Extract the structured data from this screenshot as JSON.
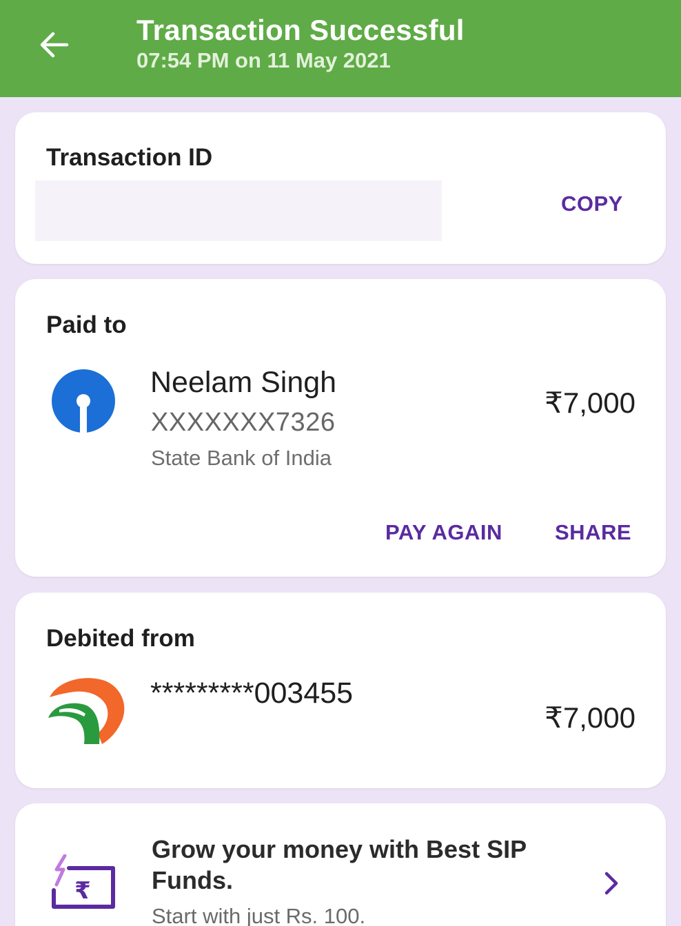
{
  "header": {
    "title": "Transaction Successful",
    "timestamp": "07:54 PM on 11 May 2021",
    "color": "#5fab47"
  },
  "transaction": {
    "label": "Transaction ID",
    "copy_label": "COPY"
  },
  "paid_to": {
    "label": "Paid to",
    "name": "Neelam Singh",
    "account": "XXXXXXX7326",
    "bank": "State Bank of India",
    "amount": "₹7,000",
    "pay_again_label": "PAY AGAIN",
    "share_label": "SHARE",
    "bank_icon": "sbi-logo-icon"
  },
  "debited_from": {
    "label": "Debited from",
    "account": "*********003455",
    "amount": "₹7,000",
    "bank_icon": "bank-logo-icon"
  },
  "promo": {
    "title": "Grow your money with Best SIP Funds.",
    "subtitle": "Start with just Rs. 100.",
    "icon": "rupee-sip-icon"
  },
  "colors": {
    "accent": "#5a2ba0",
    "background": "#ece4f6"
  }
}
